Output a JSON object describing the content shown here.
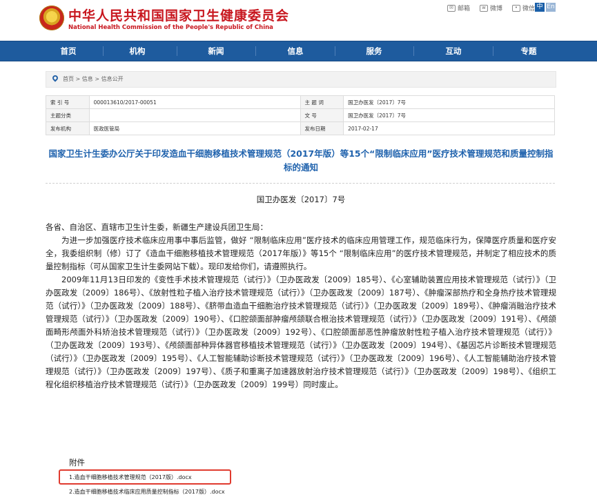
{
  "header": {
    "title": "中华人民共和国国家卫生健康委员会",
    "subtitle": "National Health Commission of the People's Republic of China",
    "tools": [
      "邮箱",
      "微博",
      "微信"
    ],
    "lang_zh": "中",
    "lang_en": "En"
  },
  "nav": [
    "首页",
    "机构",
    "新闻",
    "信息",
    "服务",
    "互动",
    "专题"
  ],
  "breadcrumb": "首页 > 信息 > 信息公开",
  "info_table": {
    "rows": [
      {
        "k1": "索 引 号",
        "v1": "000013610/2017-00051",
        "k2": "主 题 词",
        "v2": "国卫办医发〔2017〕7号"
      },
      {
        "k1": "主题分类",
        "v1": "",
        "k2": "文 号",
        "v2": "国卫办医发〔2017〕7号"
      },
      {
        "k1": "发布机构",
        "v1": "医政医管局",
        "k2": "发布日期",
        "v2": "2017-02-17"
      }
    ]
  },
  "doc": {
    "title": "国家卫生计生委办公厅关于印发造血干细胞移植技术管理规范（2017年版）等15个“限制临床应用”医疗技术管理规范和质量控制指标的通知",
    "number": "国卫办医发〔2017〕7号",
    "salutation": "各省、自治区、直辖市卫生计生委，新疆生产建设兵团卫生局：",
    "para1": "为进一步加强医疗技术临床应用事中事后监管，做好 “限制临床应用”医疗技术的临床应用管理工作，规范临床行为，保障医疗质量和医疗安全，我委组织制（修）订了《造血干细胞移植技术管理规范（2017年版）》等15个 “限制临床应用”的医疗技术管理规范，并制定了相应技术的质量控制指标（可从国家卫生计生委网站下载）。现印发给你们，请遵照执行。",
    "para2": "2009年11月13日印发的《变性手术技术管理规范（试行）》（卫办医政发〔2009〕185号）、《心室辅助装置应用技术管理规范（试行）》（卫办医政发〔2009〕186号）、《放射性粒子植入治疗技术管理规范（试行）》（卫办医政发〔2009〕187号）、《肿瘤深部热疗和全身热疗技术管理规范（试行）》（卫办医政发〔2009〕188号）、《脐带血造血干细胞治疗技术管理规范（试行）》（卫办医政发〔2009〕189号）、《肿瘤消融治疗技术管理规范（试行）》（卫办医政发〔2009〕190号）、《口腔颌面部肿瘤颅颌联合根治技术管理规范（试行）》（卫办医政发〔2009〕191号）、《颅颌面畸形颅面外科矫治技术管理规范（试行）》（卫办医政发〔2009〕192号）、《口腔颌面部恶性肿瘤放射性粒子植入治疗技术管理规范（试行）》（卫办医政发〔2009〕193号）、《颅颌面部种异体器官移植技术管理规范（试行）》（卫办医政发〔2009〕194号）、《基因芯片诊断技术管理规范（试行）》（卫办医政发〔2009〕195号）、《人工智能辅助诊断技术管理规范（试行）》（卫办医政发〔2009〕196号）、《人工智能辅助治疗技术管理规范（试行）》（卫办医政发〔2009〕197号）、《质子和重离子加速器放射治疗技术管理规范（试行）》（卫办医政发〔2009〕198号）、《组织工程化组织移植治疗技术管理规范（试行）》（卫办医政发〔2009〕199号）同时废止。"
  },
  "attachments": {
    "heading": "附件",
    "items": [
      "1.造血干细胞移植技术管理规范（2017版）.docx",
      "2.造血干细胞移植技术临床应用质量控制指标（2017版）.docx"
    ]
  }
}
